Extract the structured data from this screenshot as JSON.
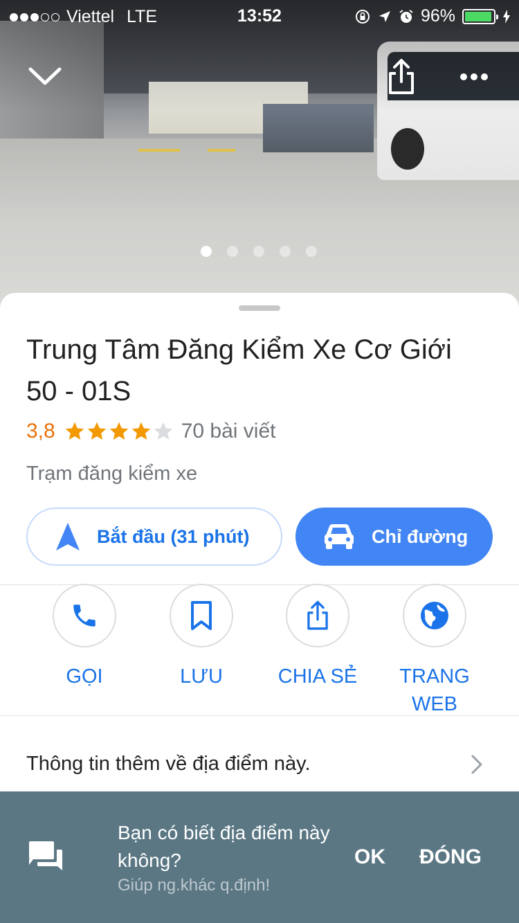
{
  "status_bar": {
    "carrier": "Viettel",
    "network": "LTE",
    "time": "13:52",
    "battery": "96%",
    "battery_level": 0.96
  },
  "hero": {
    "photo_count": 5,
    "active_photo_index": 0
  },
  "place": {
    "title": "Trung Tâm Đăng Kiểm Xe Cơ Giới 50 - 01S",
    "rating": "3,8",
    "rating_value": 3.8,
    "reviews": "70 bài viết",
    "category": "Trạm đăng kiểm xe"
  },
  "buttons": {
    "start_label": "Bắt đầu (31 phút)",
    "directions_label": "Chỉ đường"
  },
  "actions": [
    {
      "label": "GỌI",
      "icon": "phone-icon"
    },
    {
      "label": "LƯU",
      "icon": "bookmark-icon"
    },
    {
      "label": "CHIA SẺ",
      "icon": "share-icon"
    },
    {
      "label": "TRANG WEB",
      "icon": "globe-icon"
    }
  ],
  "more_info": {
    "label": "Thông tin thêm về địa điểm này."
  },
  "banner": {
    "question": "Bạn có biết địa điểm này không?",
    "subtitle": "Giúp ng.khác q.định!",
    "ok_label": "OK",
    "close_label": "ĐÓNG"
  },
  "colors": {
    "accent": "#4285f4",
    "link": "#1a73e8",
    "rating": "#e8710a",
    "banner": "#5b7784"
  }
}
